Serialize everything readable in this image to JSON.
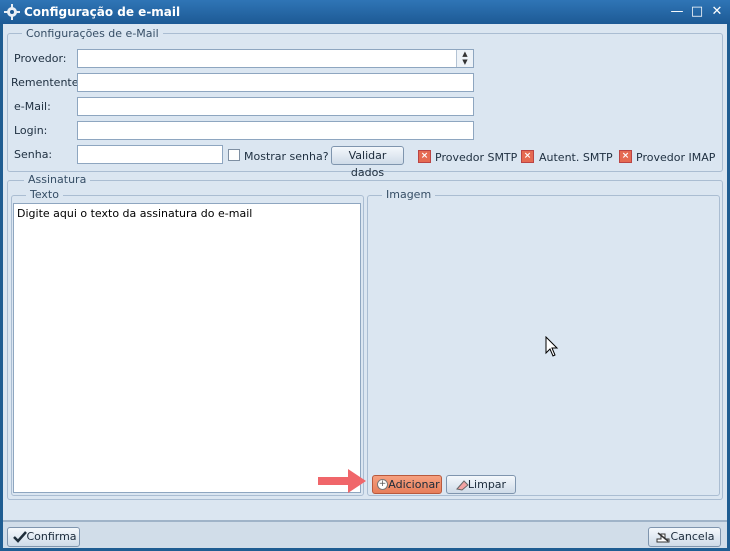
{
  "window": {
    "title": "Configuração de e-mail",
    "minimize": "—",
    "maximize": "□",
    "close": "✕"
  },
  "config_group": {
    "legend": "Configurações de e-Mail",
    "labels": {
      "provedor": "Provedor:",
      "remetente": "Rementente:",
      "email": "e-Mail:",
      "login": "Login:",
      "senha": "Senha:"
    },
    "values": {
      "provedor": "",
      "remetente": "",
      "email": "",
      "login": "",
      "senha": ""
    },
    "mostrar_senha": "Mostrar senha?",
    "validar": "Validar dados",
    "status": [
      {
        "label": "Provedor SMTP"
      },
      {
        "label": "Autent. SMTP"
      },
      {
        "label": "Provedor IMAP"
      }
    ]
  },
  "assinatura": {
    "legend": "Assinatura",
    "texto_legend": "Texto",
    "texto_value": "Digite aqui o texto da assinatura do e-mail",
    "imagem_legend": "Imagem",
    "adicionar": "Adicionar",
    "limpar": "Limpar"
  },
  "footer": {
    "confirma": "Confirma",
    "cancela": "Cancela"
  },
  "colors": {
    "titlebar": "#1d5a95",
    "accent_button": "#f08a6a",
    "arrow": "#f0666a"
  }
}
